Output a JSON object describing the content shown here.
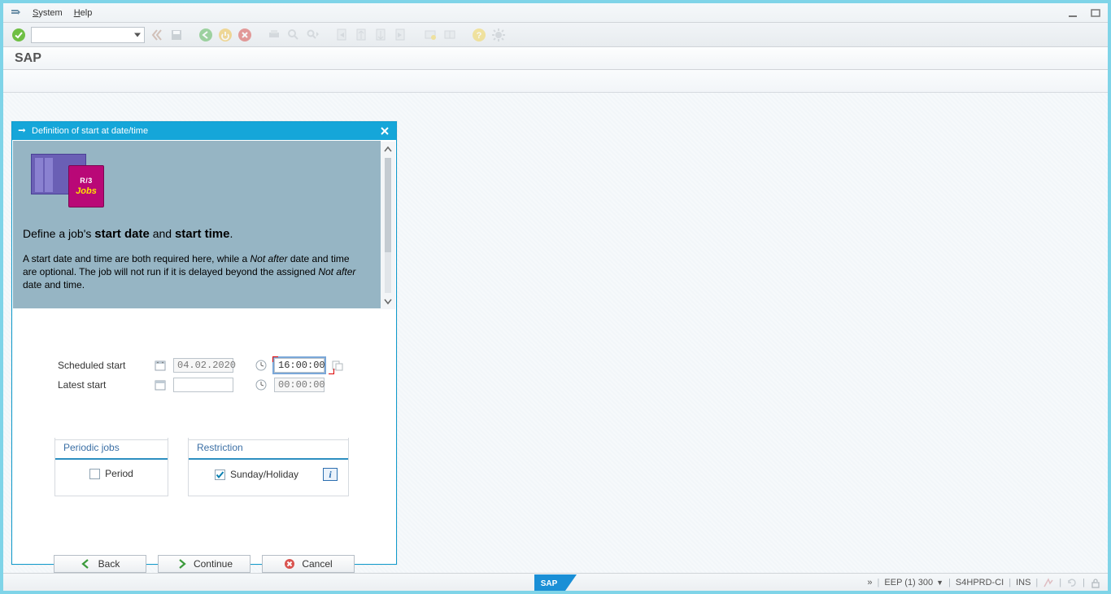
{
  "menubar": {
    "system": "System",
    "help": "Help"
  },
  "title": "SAP",
  "dialog": {
    "title": "Definition of start at date/time",
    "illustration": {
      "top": "R/3",
      "bottom": "Jobs"
    },
    "heading": {
      "prefix": "Define a job's ",
      "bold1": "start date",
      "mid": " and ",
      "bold2": "start time",
      "suffix": "."
    },
    "desc": {
      "p1": "A start date and time are both required here, while a ",
      "it1": "Not after",
      "p2": " date and time are optional. The job will not run if it is delayed beyond the assigned ",
      "it2": "Not after",
      "p3": " date and time."
    },
    "form": {
      "scheduled_label": "Scheduled start",
      "latest_label": "Latest start",
      "scheduled_date": "04.02.2020",
      "scheduled_time": "16:00:00",
      "latest_date": "",
      "latest_time": "00:00:00"
    },
    "groups": {
      "periodic_legend": "Periodic jobs",
      "period_checkbox": "Period",
      "period_checked": false,
      "restriction_legend": "Restriction",
      "sunday_checkbox": "Sunday/Holiday",
      "sunday_checked": true
    },
    "buttons": {
      "back": "Back",
      "cont": "Continue",
      "cancel": "Cancel"
    }
  },
  "status": {
    "system": "EEP (1) 300",
    "server": "S4HPRD-CI",
    "mode": "INS"
  }
}
